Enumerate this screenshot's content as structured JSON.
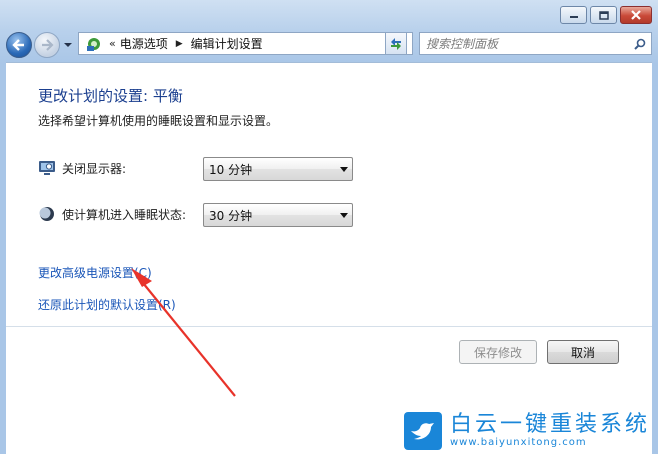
{
  "nav": {
    "breadcrumb_sep": "«",
    "crumbs": [
      "电源选项",
      "编辑计划设置"
    ],
    "crumb_arrow": "▶",
    "search_placeholder": "搜索控制面板"
  },
  "page": {
    "title": "更改计划的设置: 平衡",
    "subtitle": "选择希望计算机使用的睡眠设置和显示设置。"
  },
  "settings": [
    {
      "label": "关闭显示器:",
      "value": "10 分钟",
      "icon": "monitor-icon"
    },
    {
      "label": "使计算机进入睡眠状态:",
      "value": "30 分钟",
      "icon": "sleep-moon-icon"
    }
  ],
  "links": {
    "advanced": "更改高级电源设置(C)",
    "restore": "还原此计划的默认设置(R)"
  },
  "buttons": {
    "save": "保存修改",
    "cancel": "取消"
  },
  "watermark": {
    "title": "白云一键重装系统",
    "url": "www.baiyunxitong.com"
  },
  "colors": {
    "title": "#1b3f8f",
    "link": "#1a56b8",
    "annotation_arrow": "#e8332a",
    "watermark": "#1a86d8"
  }
}
